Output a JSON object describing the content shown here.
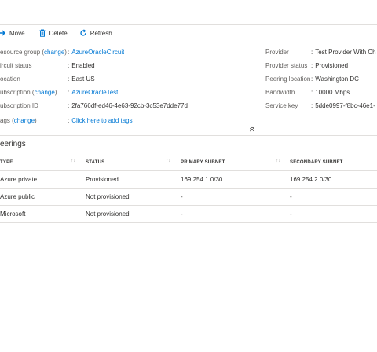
{
  "toolbar": {
    "move_label": "Move",
    "delete_label": "Delete",
    "refresh_label": "Refresh"
  },
  "essentials": {
    "left": {
      "resource_group": {
        "label": "esource group (",
        "change": "change",
        "label_end": ")",
        "value": "AzureOracleCircuit"
      },
      "circuit_status": {
        "label": "ircuit status",
        "value": "Enabled"
      },
      "location": {
        "label": "ocation",
        "value": "East US"
      },
      "subscription": {
        "label": "ubscription (",
        "change": "change",
        "label_end": ")",
        "value": "AzureOracleTest"
      },
      "subscription_id": {
        "label": "ubscription ID",
        "value": "2fa766df-ed46-4e63-92cb-3c53e7dde77d"
      },
      "tags": {
        "label": "ags (",
        "change": "change",
        "label_end": ")",
        "value": "Click here to add tags"
      }
    },
    "right": {
      "provider": {
        "label": "Provider",
        "value": "Test Provider With Ch"
      },
      "provider_status": {
        "label": "Provider status",
        "value": "Provisioned"
      },
      "peering_location": {
        "label": "Peering location",
        "value": "Washington DC"
      },
      "bandwidth": {
        "label": "Bandwidth",
        "value": "10000 Mbps"
      },
      "service_key": {
        "label": "Service key",
        "value": "5dde0997-f8bc-46e1-"
      }
    }
  },
  "peerings": {
    "title": "eerings",
    "columns": [
      "TYPE",
      "STATUS",
      "PRIMARY SUBNET",
      "SECONDARY SUBNET"
    ],
    "rows": [
      {
        "type": "Azure private",
        "status": "Provisioned",
        "primary": "169.254.1.0/30",
        "secondary": "169.254.2.0/30"
      },
      {
        "type": "Azure public",
        "status": "Not provisioned",
        "primary": "-",
        "secondary": "-"
      },
      {
        "type": "Microsoft",
        "status": "Not provisioned",
        "primary": "-",
        "secondary": "-"
      }
    ]
  },
  "icons": {
    "move": "arrow-right-icon",
    "delete": "trash-icon",
    "refresh": "refresh-icon",
    "collapse": "chevron-double-up-icon",
    "sort": "sort-icon"
  },
  "colors": {
    "link": "#0078d4",
    "text": "#323130",
    "label": "#605e5c",
    "divider": "#e1dfdd"
  }
}
